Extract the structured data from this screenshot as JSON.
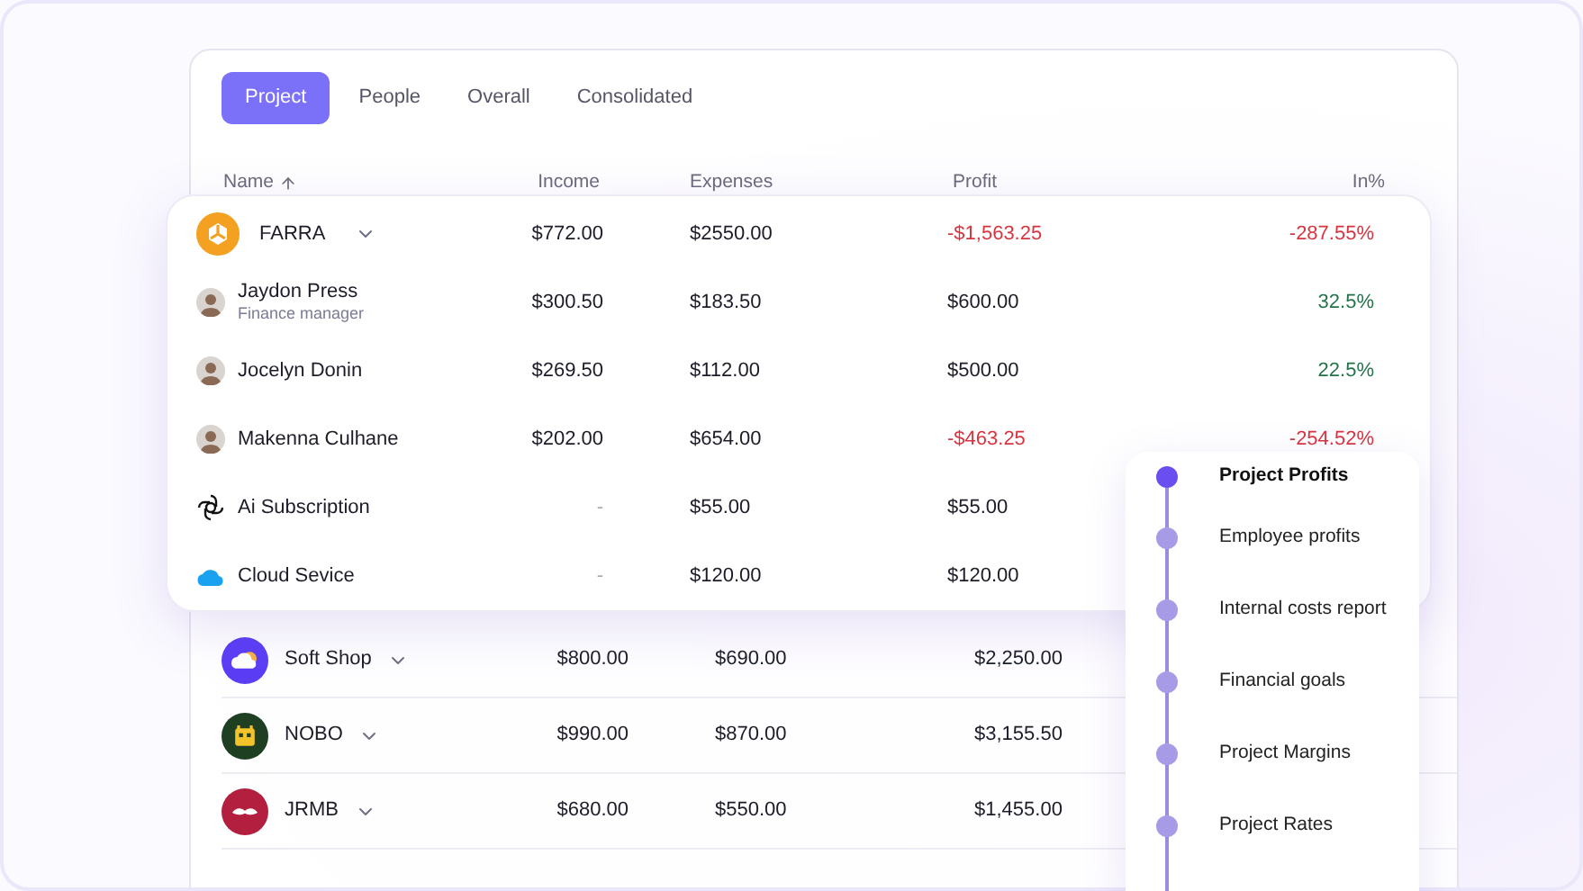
{
  "tabs": [
    {
      "label": "Project",
      "selected": true
    },
    {
      "label": "People",
      "selected": false
    },
    {
      "label": "Overall",
      "selected": false
    },
    {
      "label": "Consolidated",
      "selected": false
    }
  ],
  "columns": [
    "Name",
    "Income",
    "Expenses",
    "Profit",
    "In%"
  ],
  "featured_group": {
    "name": "FARRA",
    "kind": "hub",
    "color": "#f4a020",
    "income": "$772.00",
    "expenses": "$2550.00",
    "profit": "-$1,563.25",
    "percent": "-287.55%",
    "negative": true,
    "members": [
      {
        "kind": "person",
        "name": "Jaydon Press",
        "subtitle": "Finance manager",
        "income": "$300.50",
        "expenses": "$183.50",
        "profit": "$600.00",
        "percent": "32.5%",
        "negative": false
      },
      {
        "kind": "person",
        "name": "Jocelyn Donin",
        "income": "$269.50",
        "expenses": "$112.00",
        "profit": "$500.00",
        "percent": "22.5%",
        "negative": false
      },
      {
        "kind": "person",
        "name": "Makenna Culhane",
        "income": "$202.00",
        "expenses": "$654.00",
        "profit": "-$463.25",
        "percent": "-254.52%",
        "negative": true
      },
      {
        "kind": "ai",
        "name": "Ai Subscription",
        "income": "-",
        "expenses": "$55.00",
        "profit": "$55.00",
        "negative": false
      },
      {
        "kind": "cloud",
        "name": "Cloud Sevice",
        "income": "-",
        "expenses": "$120.00",
        "profit": "$120.00",
        "negative": false
      }
    ]
  },
  "groups": [
    {
      "name": "Soft Shop",
      "kind": "cloud",
      "color": "#5b3df5",
      "income": "$800.00",
      "expenses": "$690.00",
      "profit": "$2,250.00"
    },
    {
      "name": "NOBO",
      "kind": "robot",
      "color": "#1e3f22",
      "income": "$990.00",
      "expenses": "$870.00",
      "profit": "$3,155.50"
    },
    {
      "name": "JRMB",
      "kind": "mustache",
      "color": "#b3203f",
      "income": "$680.00",
      "expenses": "$550.00",
      "profit": "$1,455.00"
    }
  ],
  "report_menu": [
    {
      "label": "Project Profits",
      "selected": true
    },
    {
      "label": "Employee profits",
      "selected": false
    },
    {
      "label": "Internal costs report",
      "selected": false
    },
    {
      "label": "Financial goals",
      "selected": false
    },
    {
      "label": "Project Margins",
      "selected": false
    },
    {
      "label": "Project Rates",
      "selected": false
    }
  ]
}
